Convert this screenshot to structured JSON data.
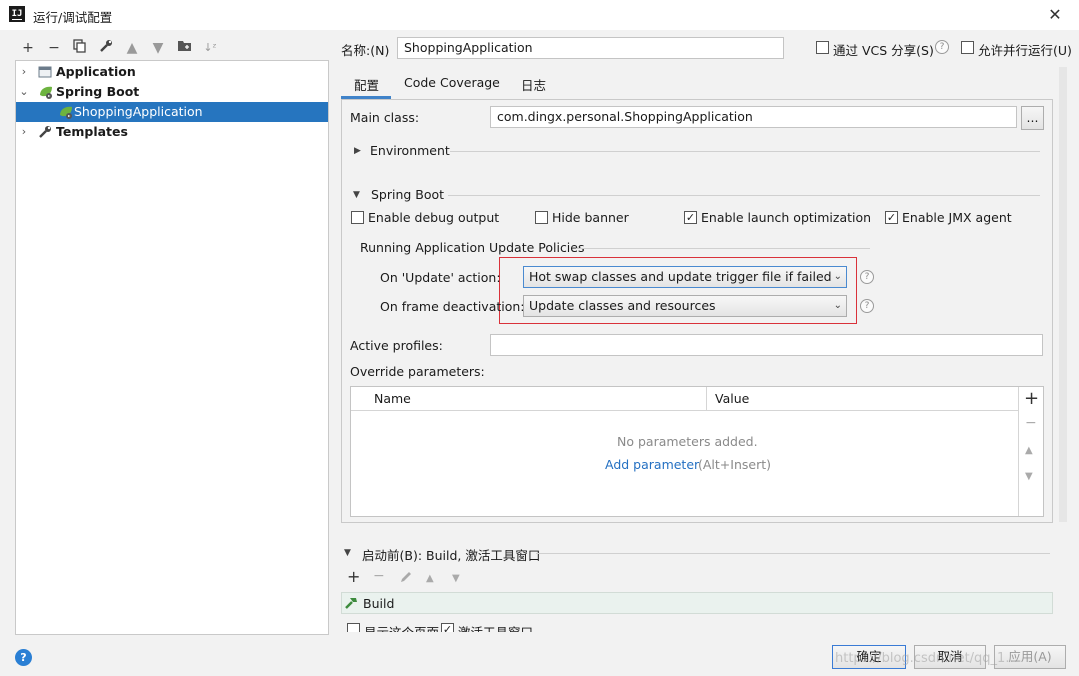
{
  "window": {
    "title": "运行/调试配置",
    "logo_text": "IJ"
  },
  "toolbar": {
    "icons": [
      "plus-icon",
      "minus-icon",
      "copy-icon",
      "wrench-icon",
      "up-arrow-icon",
      "down-arrow-icon",
      "folder-icon",
      "sort-icon"
    ]
  },
  "tree": {
    "items": [
      {
        "label": "Application"
      },
      {
        "label": "Spring Boot"
      },
      {
        "label": "ShoppingApplication"
      },
      {
        "label": "Templates"
      }
    ]
  },
  "form": {
    "name_label": "名称:(N)",
    "name_value": "ShoppingApplication",
    "vcs_label": "通过 VCS 分享(S)",
    "parallel_label": "允许并行运行(U)",
    "tabs": [
      {
        "label": "配置"
      },
      {
        "label": "Code Coverage"
      },
      {
        "label": "日志"
      }
    ],
    "main_class_label": "Main class:",
    "main_class_value": "com.dingx.personal.ShoppingApplication",
    "browse_label": "...",
    "environment_label": "Environment",
    "spring_boot_section": "Spring Boot",
    "debug_output_label": "Enable debug output",
    "hide_banner_label": "Hide banner",
    "launch_opt_label": "Enable launch optimization",
    "jmx_label": "Enable JMX agent",
    "update_policies_label": "Running Application Update Policies",
    "on_update_label": "On 'Update' action:",
    "on_update_value": "Hot swap classes and update trigger file if failed",
    "on_frame_label": "On frame deactivation:",
    "on_frame_value": "Update classes and resources",
    "active_profiles_label": "Active profiles:",
    "override_label": "Override parameters:",
    "table_headers": {
      "name": "Name",
      "value": "Value"
    },
    "no_params": "No parameters added.",
    "add_param": "Add parameter",
    "add_param_hint": "(Alt+Insert)",
    "before_launch_label": "启动前(B): Build, 激活工具窗口",
    "build_label": "Build",
    "show_page_label": "显示这个页面",
    "activate_window_label": "激活工具窗口",
    "ok_label": "确定",
    "cancel_label": "取消",
    "apply_label": "应用(A)",
    "watermark": "https://blog.csdn.net/qq_1..."
  },
  "colors": {
    "selection": "#2675bf",
    "highlight_box": "#d9323a",
    "link": "#2470c2"
  }
}
